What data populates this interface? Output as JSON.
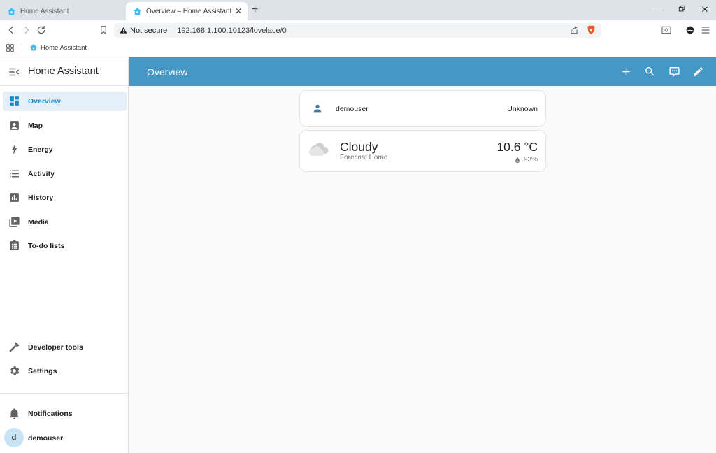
{
  "browser": {
    "tabs": [
      {
        "title": "Home Assistant"
      },
      {
        "title": "Overview – Home Assistant"
      }
    ],
    "omnibox": {
      "security_label": "Not secure",
      "url": "192.168.1.100:10123/lovelace/0"
    },
    "bookmarks": [
      {
        "label": "Home Assistant"
      }
    ]
  },
  "sidebar": {
    "title": "Home Assistant",
    "items": [
      {
        "label": "Overview",
        "icon": "dashboard-icon",
        "selected": true
      },
      {
        "label": "Map",
        "icon": "map-icon"
      },
      {
        "label": "Energy",
        "icon": "lightning-bolt-icon"
      },
      {
        "label": "Activity",
        "icon": "list-icon"
      },
      {
        "label": "History",
        "icon": "chart-box-icon"
      },
      {
        "label": "Media",
        "icon": "play-box-multiple-icon"
      },
      {
        "label": "To-do lists",
        "icon": "clipboard-list-icon"
      }
    ],
    "bottom_items": [
      {
        "label": "Developer tools",
        "icon": "hammer-icon"
      },
      {
        "label": "Settings",
        "icon": "cog-icon"
      }
    ],
    "notifications_label": "Notifications",
    "user": {
      "initial": "d",
      "name": "demouser"
    }
  },
  "main": {
    "title": "Overview",
    "actions": [
      "plus-icon",
      "search-icon",
      "assist-icon",
      "pencil-icon"
    ]
  },
  "cards": {
    "person": {
      "name": "demouser",
      "state": "Unknown"
    },
    "weather": {
      "condition": "Cloudy",
      "name": "Forecast Home",
      "temperature": "10.6 °C",
      "humidity": "93%"
    }
  },
  "colors": {
    "header": "#4598c6",
    "accent": "#03a9f4",
    "selected_bg": "#e4eff7"
  }
}
